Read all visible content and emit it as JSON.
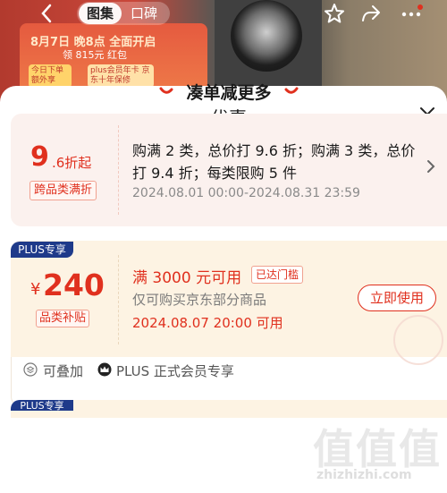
{
  "nav": {
    "back_icon": "chevron-left-icon",
    "tabs": [
      {
        "label": "图集",
        "active": true
      },
      {
        "label": "口碑",
        "active": false
      }
    ],
    "star_icon": "star-icon",
    "share_icon": "share-icon",
    "more_icon": "more-dots-icon"
  },
  "background_promo": {
    "line1": "8月7日 晚8点 全面开启",
    "line2": "领 815元 红包",
    "box1": "今日下单 额外享",
    "box2": "plus会员年卡 京东十年保修"
  },
  "sheet": {
    "title": "优惠",
    "close_icon": "close-icon",
    "section_title": "凑单减更多",
    "colors": {
      "accent": "#e0301e",
      "plus_badge": "#1e3a8a",
      "card1_bg": "#fbf1ee",
      "card2_bg": "#fdf3e3"
    }
  },
  "card1": {
    "big": "9",
    "small": ".6折起",
    "tag": "跨品类满折",
    "desc": "购满 2 类，总价打 9.6 折；购满 3 类，总价打 9.4 折；每类限购 5 件",
    "date": "2024.08.01 00:00-2024.08.31 23:59",
    "arrow_icon": "chevron-right-icon"
  },
  "card2": {
    "badge": "PLUS专享",
    "currency": "¥",
    "amount": "240",
    "tag": "品类补贴",
    "condition": "满 3000 元可用",
    "status": "已达门槛",
    "scope": "仅可购买京东部分商品",
    "time": "2024.08.07 20:00 可用",
    "button": "立即使用",
    "foot1_icon": "stack-icon",
    "foot1": "可叠加",
    "foot2_icon": "crown-icon",
    "foot2": "PLUS 正式会员专享"
  },
  "card3": {
    "badge": "PLUS专享"
  },
  "watermark": {
    "glyphs": "值值值",
    "text": "zhizhizhi.com"
  }
}
